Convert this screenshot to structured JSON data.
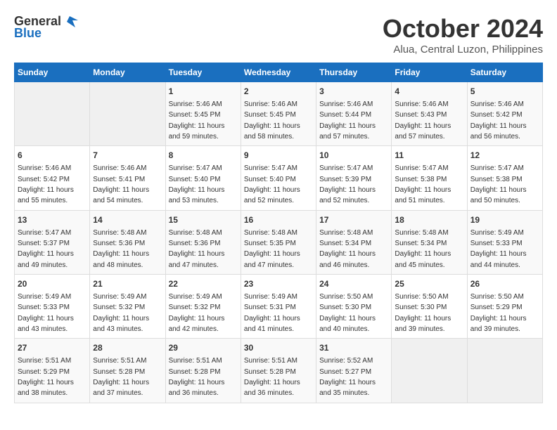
{
  "header": {
    "logo_general": "General",
    "logo_blue": "Blue",
    "month_title": "October 2024",
    "subtitle": "Alua, Central Luzon, Philippines"
  },
  "days_of_week": [
    "Sunday",
    "Monday",
    "Tuesday",
    "Wednesday",
    "Thursday",
    "Friday",
    "Saturday"
  ],
  "weeks": [
    [
      {
        "day": "",
        "sunrise": "",
        "sunset": "",
        "daylight": "",
        "empty": true
      },
      {
        "day": "",
        "sunrise": "",
        "sunset": "",
        "daylight": "",
        "empty": true
      },
      {
        "day": "1",
        "sunrise": "Sunrise: 5:46 AM",
        "sunset": "Sunset: 5:45 PM",
        "daylight": "Daylight: 11 hours and 59 minutes."
      },
      {
        "day": "2",
        "sunrise": "Sunrise: 5:46 AM",
        "sunset": "Sunset: 5:45 PM",
        "daylight": "Daylight: 11 hours and 58 minutes."
      },
      {
        "day": "3",
        "sunrise": "Sunrise: 5:46 AM",
        "sunset": "Sunset: 5:44 PM",
        "daylight": "Daylight: 11 hours and 57 minutes."
      },
      {
        "day": "4",
        "sunrise": "Sunrise: 5:46 AM",
        "sunset": "Sunset: 5:43 PM",
        "daylight": "Daylight: 11 hours and 57 minutes."
      },
      {
        "day": "5",
        "sunrise": "Sunrise: 5:46 AM",
        "sunset": "Sunset: 5:42 PM",
        "daylight": "Daylight: 11 hours and 56 minutes."
      }
    ],
    [
      {
        "day": "6",
        "sunrise": "Sunrise: 5:46 AM",
        "sunset": "Sunset: 5:42 PM",
        "daylight": "Daylight: 11 hours and 55 minutes."
      },
      {
        "day": "7",
        "sunrise": "Sunrise: 5:46 AM",
        "sunset": "Sunset: 5:41 PM",
        "daylight": "Daylight: 11 hours and 54 minutes."
      },
      {
        "day": "8",
        "sunrise": "Sunrise: 5:47 AM",
        "sunset": "Sunset: 5:40 PM",
        "daylight": "Daylight: 11 hours and 53 minutes."
      },
      {
        "day": "9",
        "sunrise": "Sunrise: 5:47 AM",
        "sunset": "Sunset: 5:40 PM",
        "daylight": "Daylight: 11 hours and 52 minutes."
      },
      {
        "day": "10",
        "sunrise": "Sunrise: 5:47 AM",
        "sunset": "Sunset: 5:39 PM",
        "daylight": "Daylight: 11 hours and 52 minutes."
      },
      {
        "day": "11",
        "sunrise": "Sunrise: 5:47 AM",
        "sunset": "Sunset: 5:38 PM",
        "daylight": "Daylight: 11 hours and 51 minutes."
      },
      {
        "day": "12",
        "sunrise": "Sunrise: 5:47 AM",
        "sunset": "Sunset: 5:38 PM",
        "daylight": "Daylight: 11 hours and 50 minutes."
      }
    ],
    [
      {
        "day": "13",
        "sunrise": "Sunrise: 5:47 AM",
        "sunset": "Sunset: 5:37 PM",
        "daylight": "Daylight: 11 hours and 49 minutes."
      },
      {
        "day": "14",
        "sunrise": "Sunrise: 5:48 AM",
        "sunset": "Sunset: 5:36 PM",
        "daylight": "Daylight: 11 hours and 48 minutes."
      },
      {
        "day": "15",
        "sunrise": "Sunrise: 5:48 AM",
        "sunset": "Sunset: 5:36 PM",
        "daylight": "Daylight: 11 hours and 47 minutes."
      },
      {
        "day": "16",
        "sunrise": "Sunrise: 5:48 AM",
        "sunset": "Sunset: 5:35 PM",
        "daylight": "Daylight: 11 hours and 47 minutes."
      },
      {
        "day": "17",
        "sunrise": "Sunrise: 5:48 AM",
        "sunset": "Sunset: 5:34 PM",
        "daylight": "Daylight: 11 hours and 46 minutes."
      },
      {
        "day": "18",
        "sunrise": "Sunrise: 5:48 AM",
        "sunset": "Sunset: 5:34 PM",
        "daylight": "Daylight: 11 hours and 45 minutes."
      },
      {
        "day": "19",
        "sunrise": "Sunrise: 5:49 AM",
        "sunset": "Sunset: 5:33 PM",
        "daylight": "Daylight: 11 hours and 44 minutes."
      }
    ],
    [
      {
        "day": "20",
        "sunrise": "Sunrise: 5:49 AM",
        "sunset": "Sunset: 5:33 PM",
        "daylight": "Daylight: 11 hours and 43 minutes."
      },
      {
        "day": "21",
        "sunrise": "Sunrise: 5:49 AM",
        "sunset": "Sunset: 5:32 PM",
        "daylight": "Daylight: 11 hours and 43 minutes."
      },
      {
        "day": "22",
        "sunrise": "Sunrise: 5:49 AM",
        "sunset": "Sunset: 5:32 PM",
        "daylight": "Daylight: 11 hours and 42 minutes."
      },
      {
        "day": "23",
        "sunrise": "Sunrise: 5:49 AM",
        "sunset": "Sunset: 5:31 PM",
        "daylight": "Daylight: 11 hours and 41 minutes."
      },
      {
        "day": "24",
        "sunrise": "Sunrise: 5:50 AM",
        "sunset": "Sunset: 5:30 PM",
        "daylight": "Daylight: 11 hours and 40 minutes."
      },
      {
        "day": "25",
        "sunrise": "Sunrise: 5:50 AM",
        "sunset": "Sunset: 5:30 PM",
        "daylight": "Daylight: 11 hours and 39 minutes."
      },
      {
        "day": "26",
        "sunrise": "Sunrise: 5:50 AM",
        "sunset": "Sunset: 5:29 PM",
        "daylight": "Daylight: 11 hours and 39 minutes."
      }
    ],
    [
      {
        "day": "27",
        "sunrise": "Sunrise: 5:51 AM",
        "sunset": "Sunset: 5:29 PM",
        "daylight": "Daylight: 11 hours and 38 minutes."
      },
      {
        "day": "28",
        "sunrise": "Sunrise: 5:51 AM",
        "sunset": "Sunset: 5:28 PM",
        "daylight": "Daylight: 11 hours and 37 minutes."
      },
      {
        "day": "29",
        "sunrise": "Sunrise: 5:51 AM",
        "sunset": "Sunset: 5:28 PM",
        "daylight": "Daylight: 11 hours and 36 minutes."
      },
      {
        "day": "30",
        "sunrise": "Sunrise: 5:51 AM",
        "sunset": "Sunset: 5:28 PM",
        "daylight": "Daylight: 11 hours and 36 minutes."
      },
      {
        "day": "31",
        "sunrise": "Sunrise: 5:52 AM",
        "sunset": "Sunset: 5:27 PM",
        "daylight": "Daylight: 11 hours and 35 minutes."
      },
      {
        "day": "",
        "sunrise": "",
        "sunset": "",
        "daylight": "",
        "empty": true
      },
      {
        "day": "",
        "sunrise": "",
        "sunset": "",
        "daylight": "",
        "empty": true
      }
    ]
  ]
}
